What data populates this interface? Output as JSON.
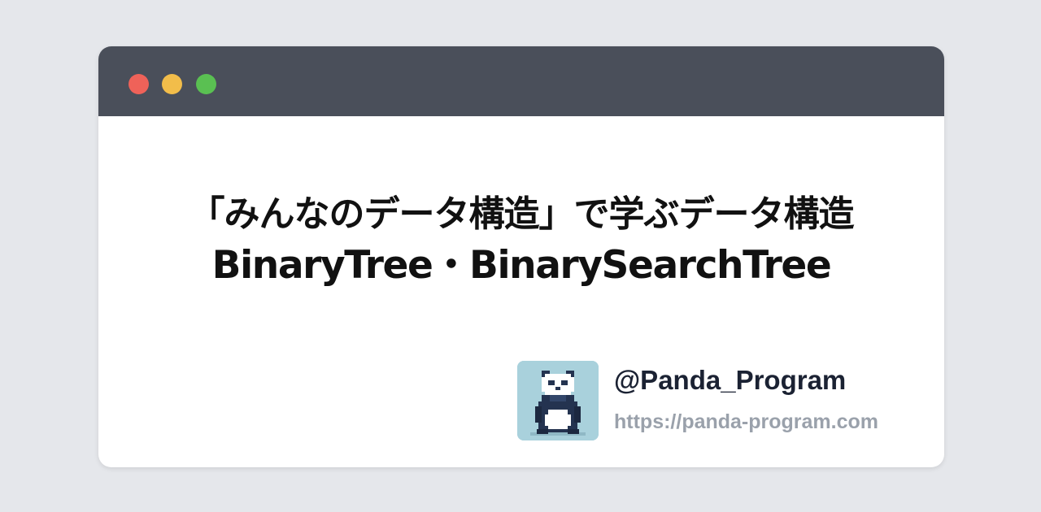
{
  "window": {
    "controls": [
      {
        "name": "close",
        "color": "#ef6259"
      },
      {
        "name": "minimize",
        "color": "#f2bd4a"
      },
      {
        "name": "maximize",
        "color": "#5ac052"
      }
    ]
  },
  "title": {
    "line1": "「みんなのデータ構造」で学ぶデータ構造",
    "line2": "BinaryTree・BinarySearchTree"
  },
  "author": {
    "avatar_icon": "panda-avatar-icon",
    "handle": "@Panda_Program",
    "url": "https://panda-program.com"
  },
  "colors": {
    "background": "#e5e7eb",
    "titlebar": "#4a4f5a",
    "card": "#ffffff",
    "title_text": "#111111",
    "handle_text": "#1b2233",
    "url_text": "#9aa1ab"
  }
}
